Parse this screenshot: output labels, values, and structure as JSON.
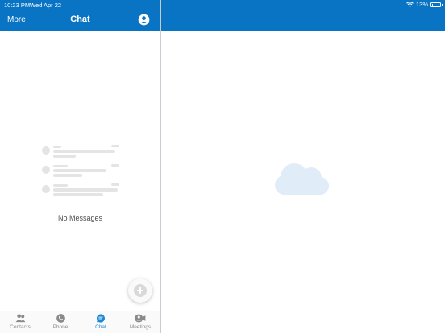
{
  "status_bar": {
    "time": "10:23 PM",
    "date": "Wed Apr 22",
    "battery": "13%",
    "battery_level": 0.13
  },
  "nav": {
    "more_label": "More",
    "title": "Chat"
  },
  "empty_state": {
    "message": "No Messages"
  },
  "tabs": [
    {
      "label": "Contacts",
      "icon": "contacts-icon"
    },
    {
      "label": "Phone",
      "icon": "phone-icon"
    },
    {
      "label": "Chat",
      "icon": "chat-icon",
      "active": true
    },
    {
      "label": "Meetings",
      "icon": "meetings-icon"
    }
  ],
  "colors": {
    "header": "#0a74c4",
    "accent": "#1a86d6",
    "cloud": "#e0edf8"
  }
}
